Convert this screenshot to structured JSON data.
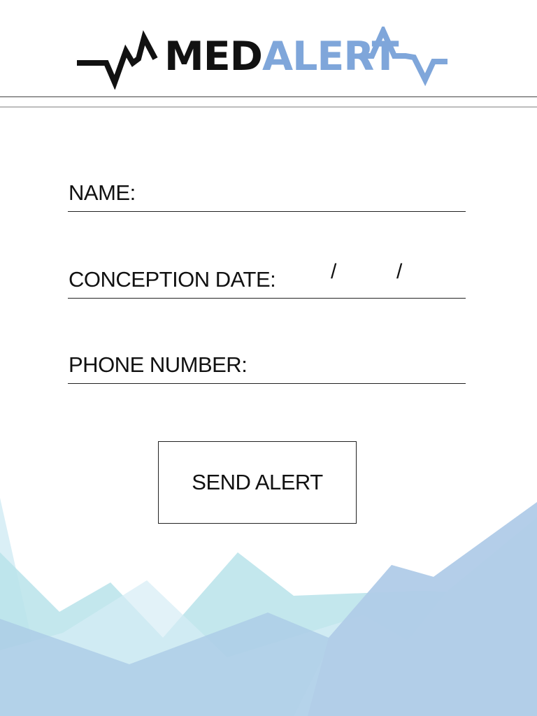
{
  "app": {
    "brand_primary": "MED",
    "brand_secondary": "ALERT"
  },
  "colors": {
    "brand_dark": "#111111",
    "brand_accent": "#7fa6da",
    "mountain_light": "#d6edf5",
    "mountain_teal": "#b9e3ea",
    "mountain_blue": "#a9c9e5",
    "mountain_lavender": "#c9d6ee"
  },
  "form": {
    "name": {
      "label": "NAME:",
      "value": ""
    },
    "conception_date": {
      "label": "CONCEPTION DATE:",
      "separator": "/",
      "month": "",
      "day": "",
      "year": ""
    },
    "phone": {
      "label": "PHONE NUMBER:",
      "value": ""
    }
  },
  "actions": {
    "send_label": "SEND ALERT"
  }
}
